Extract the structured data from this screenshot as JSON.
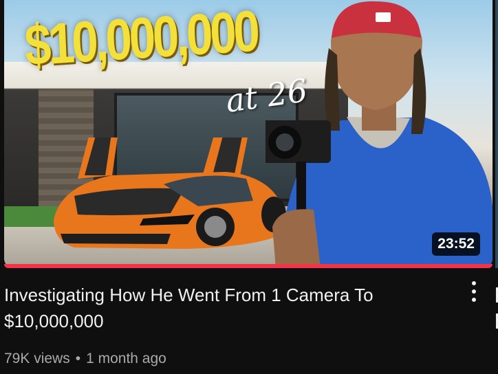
{
  "video": {
    "thumbnail_headline": "$10,000,000",
    "thumbnail_subline": "at 26",
    "duration": "23:52",
    "watch_progress_fraction": 1.0,
    "title": "Investigating How He Went From 1 Camera To $10,000,000",
    "views": "79K views",
    "separator": "•",
    "age": "1 month ago"
  },
  "icons": {
    "menu": "more-vert-icon"
  },
  "colors": {
    "background": "#0f0f0f",
    "title_text": "#f1f1f1",
    "meta_text": "#aaaaaa",
    "progress": "#f2344b",
    "headline_yellow": "#f4e03a",
    "car_orange": "#e8761c",
    "hoodie_blue": "#2a62c9",
    "cap_red": "#c8313d"
  }
}
